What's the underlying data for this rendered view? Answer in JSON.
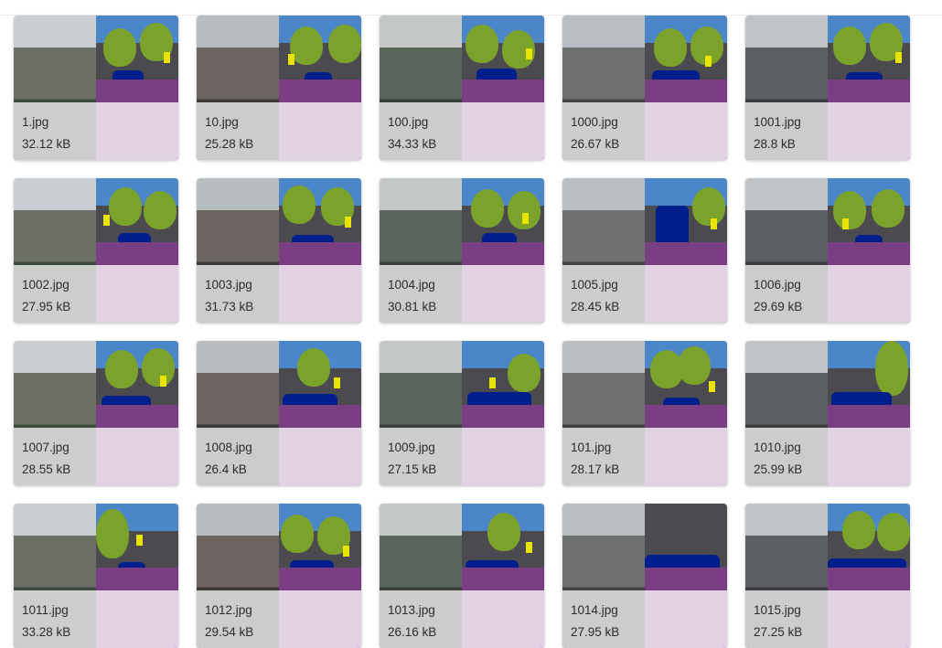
{
  "files": [
    {
      "name": "1.jpg",
      "size": "32.12 kB"
    },
    {
      "name": "10.jpg",
      "size": "25.28 kB"
    },
    {
      "name": "100.jpg",
      "size": "34.33 kB"
    },
    {
      "name": "1000.jpg",
      "size": "26.67 kB"
    },
    {
      "name": "1001.jpg",
      "size": "28.8 kB"
    },
    {
      "name": "1002.jpg",
      "size": "27.95 kB"
    },
    {
      "name": "1003.jpg",
      "size": "31.73 kB"
    },
    {
      "name": "1004.jpg",
      "size": "30.81 kB"
    },
    {
      "name": "1005.jpg",
      "size": "28.45 kB"
    },
    {
      "name": "1006.jpg",
      "size": "29.69 kB"
    },
    {
      "name": "1007.jpg",
      "size": "28.55 kB"
    },
    {
      "name": "1008.jpg",
      "size": "26.4 kB"
    },
    {
      "name": "1009.jpg",
      "size": "27.15 kB"
    },
    {
      "name": "101.jpg",
      "size": "28.17 kB"
    },
    {
      "name": "1010.jpg",
      "size": "25.99 kB"
    },
    {
      "name": "1011.jpg",
      "size": "33.28 kB"
    },
    {
      "name": "1012.jpg",
      "size": "29.54 kB"
    },
    {
      "name": "1013.jpg",
      "size": "26.16 kB"
    },
    {
      "name": "1014.jpg",
      "size": "27.95 kB"
    },
    {
      "name": "1015.jpg",
      "size": "27.25 kB"
    }
  ],
  "colors": {
    "seg_sky": "#4a86c8",
    "seg_building": "#4a4a4f",
    "seg_vegetation": "#7ba32b",
    "seg_car": "#001f8c",
    "seg_road": "#7a3f82",
    "seg_sign": "#e8e300"
  }
}
